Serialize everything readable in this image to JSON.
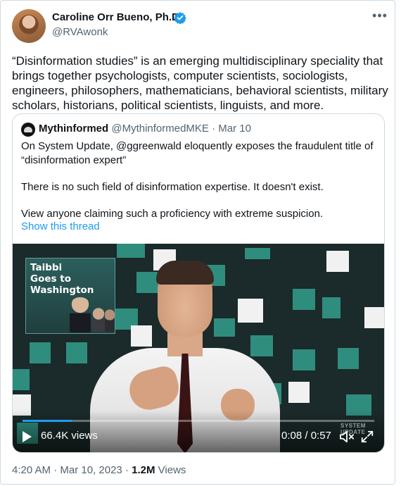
{
  "tweet": {
    "author_name": "Caroline Orr Bueno, Ph.D",
    "handle": "@RVAwonk",
    "more_icon": "more-horizontal-icon",
    "verified_icon": "verified-badge-icon",
    "verified_color": "#1d9bf0",
    "text": "“Disinformation studies” is an emerging multidisciplinary speciality that brings together psychologists, computer scientists, sociologists, engineers, philosophers, mathematicians, behavioral scientists, military scholars, historians, political scientists, linguists, and more."
  },
  "quote": {
    "author_name": "Mythinformed",
    "handle": "@MythinformedMKE",
    "separator": "·",
    "date": "Mar 10",
    "paragraphs": [
      "On System Update, @ggreenwald eloquently exposes the fraudulent title of “disinformation expert”",
      "There is no such field of disinformation expertise.  It doesn't exist.",
      "View anyone claiming such a proficiency with extreme suspicion."
    ],
    "thread_link": "Show this thread"
  },
  "video": {
    "inset_title": "Taibbi\nGoes to\nWashington",
    "views": "66.4K views",
    "time": "0:08 / 0:57",
    "progress_fraction": 0.14,
    "watermark": "SYSTEM UPDATE",
    "play_icon": "play-icon",
    "mute_icon": "volume-muted-icon",
    "expand_icon": "fullscreen-icon",
    "accent": "#1d9bf0"
  },
  "footer": {
    "time": "4:20 AM",
    "separator": "·",
    "date": "Mar 10, 2023",
    "views_count": "1.2M",
    "views_label": "Views"
  }
}
